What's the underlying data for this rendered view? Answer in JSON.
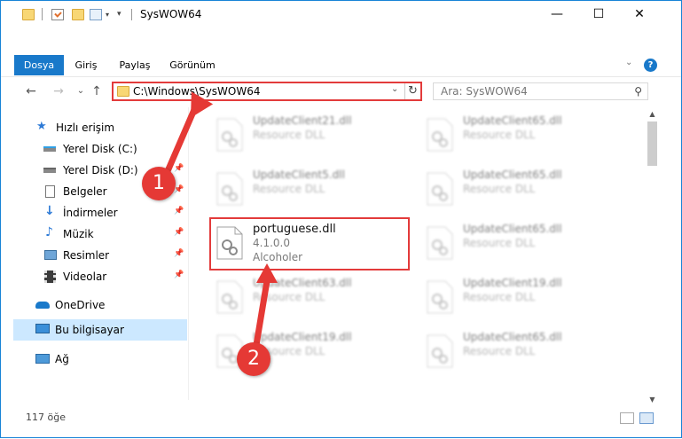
{
  "window": {
    "title": "SysWOW64",
    "controls": {
      "minimize": "—",
      "maximize": "☐",
      "close": "✕"
    }
  },
  "ribbon": {
    "tabs": [
      {
        "label": "Dosya",
        "active": true
      },
      {
        "label": "Giriş",
        "active": false
      },
      {
        "label": "Paylaş",
        "active": false
      },
      {
        "label": "Görünüm",
        "active": false
      }
    ],
    "expand_icon": "chevron-down-icon",
    "help": "?"
  },
  "nav": {
    "back": "←",
    "forward": "→",
    "recent": "⌄",
    "up": "↑",
    "address": "C:\\Windows\\SysWOW64",
    "search_placeholder": "Ara: SysWOW64"
  },
  "sidebar": {
    "items": [
      {
        "label": "Hızlı erişim",
        "icon": "star-icon",
        "pinned": false
      },
      {
        "label": "Yerel Disk (C:)",
        "icon": "drive-icon",
        "pinned": true
      },
      {
        "label": "Yerel Disk (D:)",
        "icon": "drive-icon",
        "pinned": true
      },
      {
        "label": "Belgeler",
        "icon": "documents-icon",
        "pinned": true
      },
      {
        "label": "İndirmeler",
        "icon": "download-icon",
        "pinned": true
      },
      {
        "label": "Müzik",
        "icon": "music-icon",
        "pinned": true
      },
      {
        "label": "Resimler",
        "icon": "pictures-icon",
        "pinned": true
      },
      {
        "label": "Videolar",
        "icon": "videos-icon",
        "pinned": true
      },
      {
        "label": "OneDrive",
        "icon": "cloud-icon",
        "pinned": false
      },
      {
        "label": "Bu bilgisayar",
        "icon": "computer-icon",
        "pinned": false,
        "selected": true
      },
      {
        "label": "Ağ",
        "icon": "network-icon",
        "pinned": false
      }
    ]
  },
  "files": [
    {
      "name": "UpdateClient21.dll",
      "sub1": "Resource DLL",
      "sub2": "",
      "blurred": true
    },
    {
      "name": "UpdateClient65.dll",
      "sub1": "Resource DLL",
      "sub2": "",
      "blurred": true
    },
    {
      "name": "UpdateClient5.dll",
      "sub1": "Resource DLL",
      "sub2": "",
      "blurred": true
    },
    {
      "name": "UpdateClient65.dll",
      "sub1": "Resource DLL",
      "sub2": "",
      "blurred": true
    },
    {
      "name": "portuguese.dll",
      "sub1": "4.1.0.0",
      "sub2": "Alcoholer",
      "blurred": false
    },
    {
      "name": "UpdateClient65.dll",
      "sub1": "Resource DLL",
      "sub2": "",
      "blurred": true
    },
    {
      "name": "UpdateClient63.dll",
      "sub1": "Resource DLL",
      "sub2": "",
      "blurred": true
    },
    {
      "name": "UpdateClient19.dll",
      "sub1": "Resource DLL",
      "sub2": "",
      "blurred": true
    },
    {
      "name": "UpdateClient19.dll",
      "sub1": "Resource DLL",
      "sub2": "",
      "blurred": true
    },
    {
      "name": "UpdateClient65.dll",
      "sub1": "Resource DLL",
      "sub2": "",
      "blurred": true
    }
  ],
  "status": {
    "item_count": "117 öğe"
  },
  "annotations": [
    {
      "number": "1"
    },
    {
      "number": "2"
    }
  ],
  "colors": {
    "accent": "#1979ca",
    "annotation": "#e53935",
    "selection": "#cce8ff"
  }
}
